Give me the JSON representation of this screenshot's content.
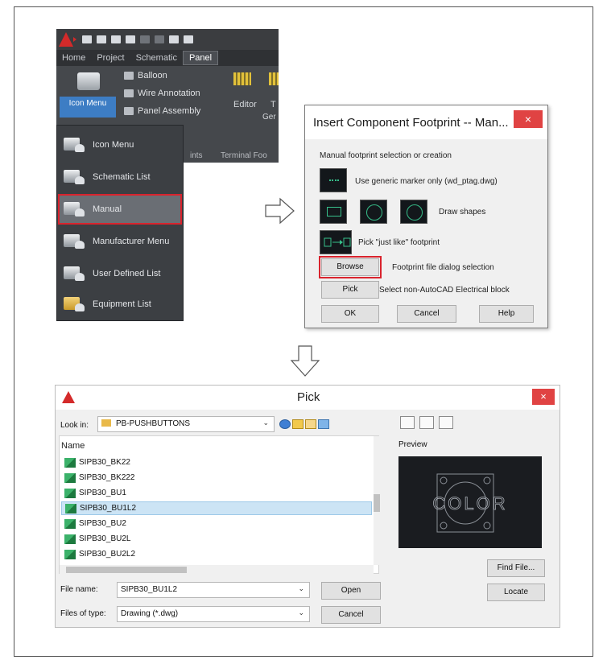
{
  "ribbon": {
    "tabs": [
      "Home",
      "Project",
      "Schematic",
      "Panel"
    ],
    "active_tab": "Panel",
    "big_button": "Icon Menu",
    "items": [
      "Balloon",
      "Wire Annotation",
      "Panel Assembly"
    ],
    "editor": "Editor",
    "t_partial": "T",
    "gen_partial": "Ger",
    "groups": [
      "ints",
      "Terminal Foo"
    ]
  },
  "dropdown": {
    "items": [
      "Icon Menu",
      "Schematic List",
      "Manual",
      "Manufacturer Menu",
      "User Defined List",
      "Equipment List"
    ],
    "selected": "Manual"
  },
  "footprint_dialog": {
    "title": "Insert Component Footprint -- Man...",
    "close": "×",
    "heading": "Manual footprint selection or creation",
    "generic_marker": "Use generic marker only (wd_ptag.dwg)",
    "draw_shapes": "Draw shapes",
    "pick_just_like": "Pick \"just like\" footprint",
    "browse": "Browse",
    "browse_desc": "Footprint file dialog selection",
    "pick": "Pick",
    "pick_desc": "Select non-AutoCAD Electrical block",
    "ok": "OK",
    "cancel": "Cancel",
    "help": "Help"
  },
  "pick_dialog": {
    "title": "Pick",
    "close": "×",
    "look_in_label": "Look in:",
    "look_in_value": "PB-PUSHBUTTONS",
    "column_name": "Name",
    "files": [
      "SIPB30_BK22",
      "SIPB30_BK222",
      "SIPB30_BU1",
      "SIPB30_BU1L2",
      "SIPB30_BU2",
      "SIPB30_BU2L",
      "SIPB30_BU2L2"
    ],
    "selected_file": "SIPB30_BU1L2",
    "preview_label": "Preview",
    "preview_text": "COLOR",
    "file_name_label": "File name:",
    "file_name_value": "SIPB30_BU1L2",
    "files_of_type_label": "Files of type:",
    "files_of_type_value": "Drawing (*.dwg)",
    "open": "Open",
    "cancel": "Cancel",
    "find_file": "Find File...",
    "locate": "Locate"
  }
}
